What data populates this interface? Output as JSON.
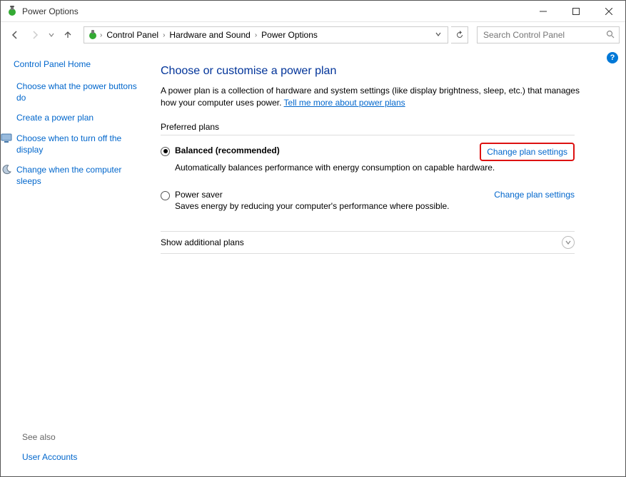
{
  "window": {
    "title": "Power Options"
  },
  "address": {
    "crumbs": [
      "Control Panel",
      "Hardware and Sound",
      "Power Options"
    ]
  },
  "search": {
    "placeholder": "Search Control Panel"
  },
  "sidebar": {
    "home": "Control Panel Home",
    "tasks": [
      {
        "label": "Choose what the power buttons do",
        "icon": null
      },
      {
        "label": "Create a power plan",
        "icon": null
      },
      {
        "label": "Choose when to turn off the display",
        "icon": "monitor"
      },
      {
        "label": "Change when the computer sleeps",
        "icon": "moon"
      }
    ],
    "see_also_label": "See also",
    "see_also": [
      {
        "label": "User Accounts"
      }
    ]
  },
  "main": {
    "title": "Choose or customise a power plan",
    "description": "A power plan is a collection of hardware and system settings (like display brightness, sleep, etc.) that manages how your computer uses power. ",
    "more_link": "Tell me more about power plans",
    "preferred_label": "Preferred plans",
    "plans": [
      {
        "name": "Balanced (recommended)",
        "desc": "Automatically balances performance with energy consumption on capable hardware.",
        "selected": true,
        "change_label": "Change plan settings",
        "highlighted": true
      },
      {
        "name": "Power saver",
        "desc": "Saves energy by reducing your computer's performance where possible.",
        "selected": false,
        "change_label": "Change plan settings",
        "highlighted": false
      }
    ],
    "show_additional": "Show additional plans"
  }
}
